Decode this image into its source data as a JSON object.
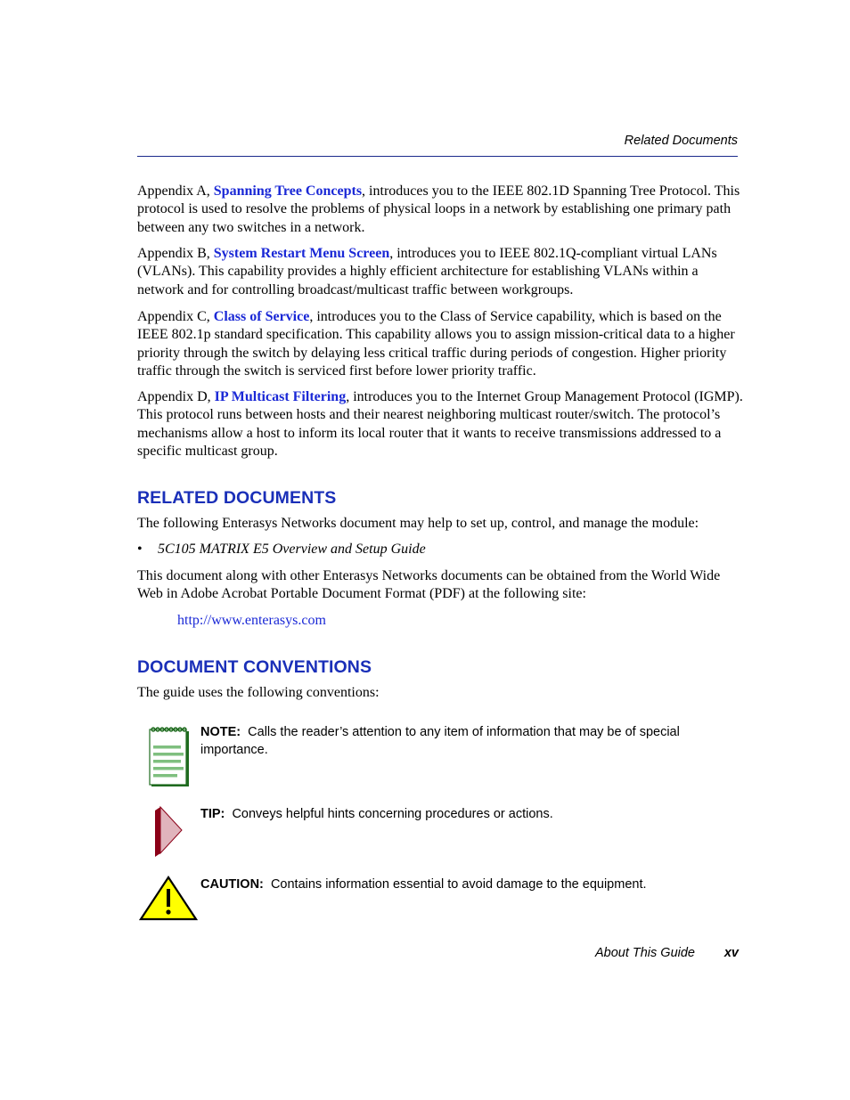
{
  "header": {
    "running_title": "Related Documents"
  },
  "appendices": [
    {
      "prefix": "Appendix A, ",
      "link": "Spanning Tree Concepts",
      "text": ", introduces you to the IEEE 802.1D Spanning Tree Protocol. This protocol is used to resolve the problems of physical loops in a network by establishing one primary path between any two switches in a network."
    },
    {
      "prefix": "Appendix B, ",
      "link": "System Restart Menu Screen",
      "text": ", introduces you to IEEE 802.1Q-compliant virtual LANs (VLANs). This capability provides a highly efficient architecture for establishing VLANs within a network and for controlling broadcast/multicast traffic between workgroups."
    },
    {
      "prefix": "Appendix C, ",
      "link": "Class of Service",
      "text": ", introduces you to the Class of Service capability, which is based on the IEEE 802.1p standard specification. This capability allows you to assign mission-critical data to a higher priority through the switch by delaying less critical traffic during periods of congestion. Higher priority traffic through the switch is serviced first before lower priority traffic."
    },
    {
      "prefix": "Appendix D, ",
      "link": "IP Multicast Filtering",
      "text": ", introduces you to the Internet Group Management Protocol (IGMP). This protocol runs between hosts and their nearest neighboring multicast router/switch. The protocol’s mechanisms allow a host to inform its local router that it wants to receive transmissions addressed to a specific multicast group."
    }
  ],
  "related_documents": {
    "heading": "RELATED DOCUMENTS",
    "intro": "The following Enterasys Networks document may help to set up, control, and manage the module:",
    "bullet_symbol": "•",
    "items": [
      "5C105 MATRIX E5 Overview and Setup Guide"
    ],
    "availability": "This document along with other Enterasys Networks documents can be obtained from the World Wide Web in Adobe Acrobat Portable Document Format (PDF) at the following site:",
    "url": "http://www.enterasys.com"
  },
  "document_conventions": {
    "heading": "DOCUMENT CONVENTIONS",
    "intro": "The guide uses the following conventions:",
    "items": [
      {
        "icon": "note-pad-icon",
        "label": "NOTE:",
        "text": "Calls the reader’s attention to any item of information that may be of special importance."
      },
      {
        "icon": "tip-arrow-icon",
        "label": "TIP:",
        "text": "Conveys helpful hints concerning procedures or actions."
      },
      {
        "icon": "caution-triangle-icon",
        "label": "CAUTION:",
        "text": "Contains information essential to avoid damage to the equipment."
      }
    ]
  },
  "colors": {
    "heading_blue": "#1a2fb8",
    "link_blue": "#1a28d6",
    "note_green": "#1f6b1f",
    "tip_red": "#8b0017",
    "caution_yellow": "#ffff00"
  },
  "footer": {
    "title": "About This Guide",
    "page_number": "xv"
  }
}
